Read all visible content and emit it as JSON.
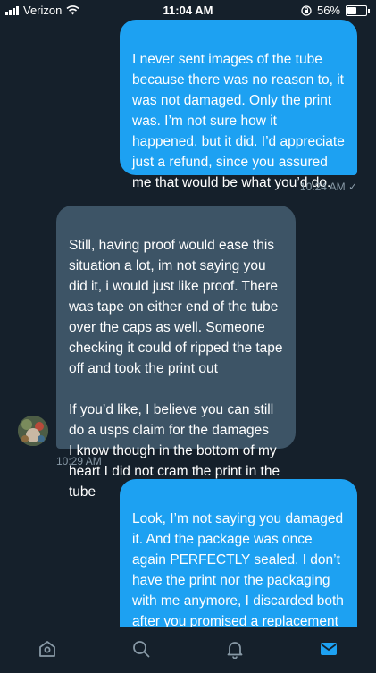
{
  "status_bar": {
    "carrier": "Verizon",
    "time": "11:04 AM",
    "battery_percent": "56%",
    "battery_level": 0.56
  },
  "conversation": {
    "messages": [
      {
        "direction": "outgoing",
        "text": "I never sent images of the tube because there was no reason to, it was not damaged. Only the print was. I’m not sure how it happened, but it did. I’d appreciate just a refund, since you assured me that would be what you’d do.",
        "timestamp": "10:24 AM ✓"
      },
      {
        "direction": "incoming",
        "text": "Still, having proof would ease this situation a lot, im not saying you did it, i would just like proof. There was tape on either end of the tube over the caps as well. Someone checking it could of ripped the tape off and took the print out\n\nIf you’d like, I believe you can still do a usps claim for the damages\nI know though in the bottom of my heart I did not cram the print in the tube",
        "timestamp": "10:29 AM"
      },
      {
        "direction": "outgoing",
        "text": "Look, I’m not saying you damaged it. And the package was once again PERFECTLY sealed. I don’t have the print nor the packaging with me anymore, I discarded both after you promised a replacement and refund. It would be too late now to even file a",
        "timestamp": ""
      }
    ]
  },
  "tab_bar": {
    "tabs": [
      "home-icon",
      "search-icon",
      "notifications-icon",
      "messages-icon"
    ],
    "active": "messages-icon",
    "accent_color": "#1da1f2"
  }
}
